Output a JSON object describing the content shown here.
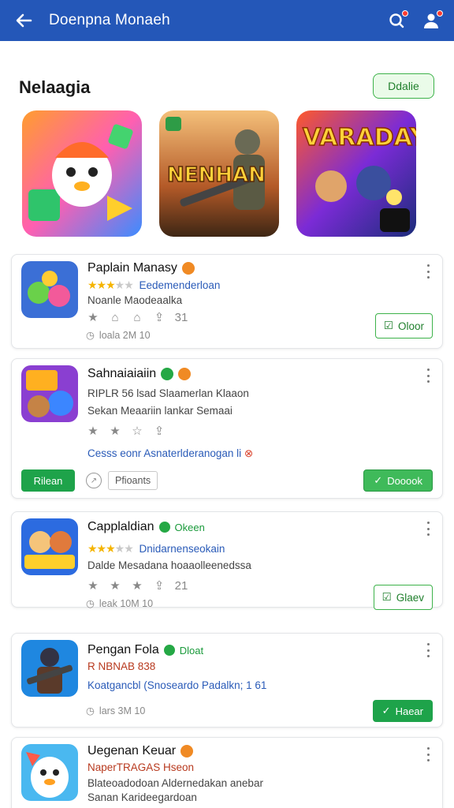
{
  "topbar": {
    "title": "Doenpna Monaeh"
  },
  "section": {
    "title": "Nelaagia",
    "button": "Ddalie"
  },
  "cards": [
    {
      "name": "Paplain Manasy",
      "rating_text": "Eedemenderloan",
      "desc": "Noanle Maodeaalka",
      "stat_count": "31",
      "info": "loala 2M 10",
      "button": "Oloor"
    },
    {
      "name": "Sahnaiaiaiin",
      "line1": "RIPLR 56 lsad  Slaamerlan Klaaon",
      "line2": "Sekan Meaariin lankar Semaai",
      "extra": "Cesss eonr Asnaterlderanogan li",
      "left_button": "Rilean",
      "ghost_button": "Pfioants",
      "button": "Dooook"
    },
    {
      "name": "Capplaldian",
      "tag": "Okeen",
      "rating_text": "Dnidarnenseokain",
      "desc": "Dalde Mesadana hoaaolleenedssa",
      "stat_count": "21",
      "info": "leak 10M 10",
      "button": "Glaev"
    },
    {
      "name": "Pengan Fola",
      "tag": "Dloat",
      "line1": "R NBNAB 838",
      "line2": "Koatgancbl (Snoseardo Padalkn; 1 61",
      "info": "lars 3M 10",
      "button": "Haear"
    },
    {
      "name": "Uegenan Keuar",
      "line1": "NaperTRAGAS Hseon",
      "line2": "Blateoadodoan Aldernedakan anebar",
      "line3": "Sanan Karideegardoan"
    }
  ],
  "colors": {
    "topbar": "#2457b8",
    "accent_green": "#1ea34a",
    "star": "#f5b400"
  }
}
